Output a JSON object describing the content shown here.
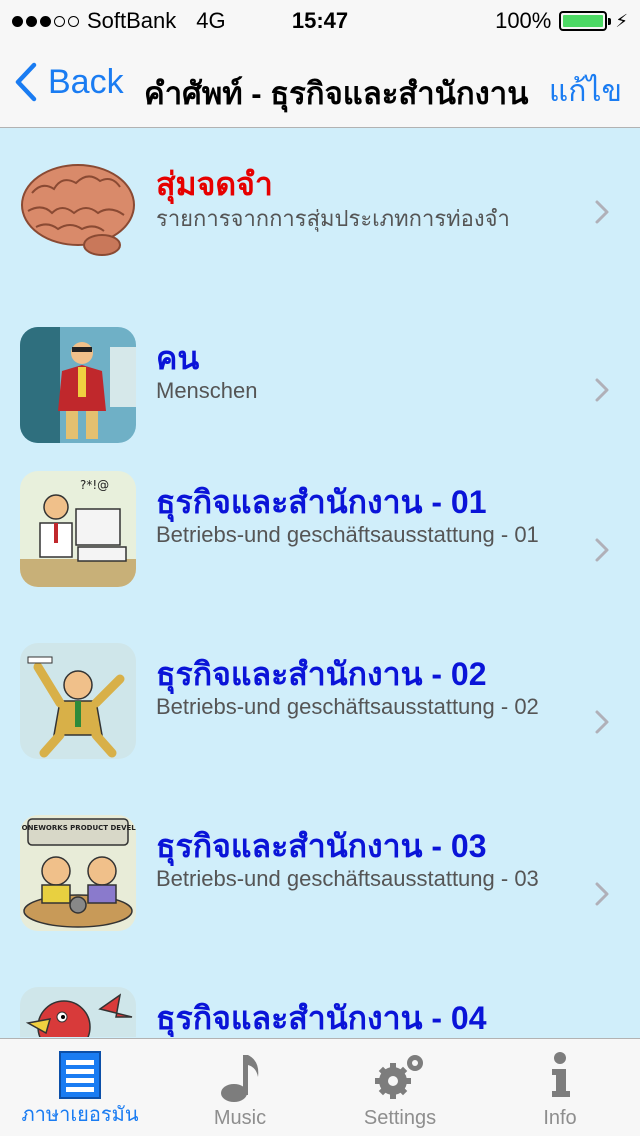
{
  "status": {
    "carrier": "SoftBank",
    "network": "4G",
    "time": "15:47",
    "battery": "100%",
    "signal_bars_filled": 3,
    "signal_bars_total": 5
  },
  "nav": {
    "back_label": "Back",
    "title": "คำศัพท์ - ธุรกิจและสำนักงาน",
    "edit_label": "แก้ไข"
  },
  "rows": [
    {
      "title": "สุ่มจดจำ",
      "subtitle": "รายการจากการสุ่มประเภทการท่องจำ",
      "icon": "brain-icon",
      "title_color": "#e60000"
    },
    {
      "title": "คน",
      "subtitle": "Menschen",
      "icon": "businessman-icon",
      "title_color": "#0a14d8"
    },
    {
      "title": "ธุรกิจและสำนักงาน - 01",
      "subtitle": "Betriebs-und geschäftsausstattung - 01",
      "icon": "computer-worker-icon",
      "title_color": "#0a14d8"
    },
    {
      "title": "ธุรกิจและสำนักงาน - 02",
      "subtitle": "Betriebs-und geschäftsausstattung - 02",
      "icon": "cheering-man-icon",
      "title_color": "#0a14d8"
    },
    {
      "title": "ธุรกิจและสำนักงาน - 03",
      "subtitle": "Betriebs-und geschäftsausstattung - 03",
      "icon": "cavemen-sign-icon",
      "title_color": "#0a14d8"
    },
    {
      "title": "ธุรกิจและสำนักงาน - 04",
      "subtitle": "",
      "icon": "bird-icon",
      "title_color": "#0a14d8"
    }
  ],
  "thumb_texts": {
    "sign": "ACME STONEWORKS PRODUCT DEVELOPMENT"
  },
  "tabs": [
    {
      "label": "ภาษาเยอรมัน",
      "icon": "list-icon",
      "active": true
    },
    {
      "label": "Music",
      "icon": "music-note-icon",
      "active": false
    },
    {
      "label": "Settings",
      "icon": "gears-icon",
      "active": false
    },
    {
      "label": "Info",
      "icon": "info-icon",
      "active": false
    }
  ],
  "colors": {
    "accent": "#1a7cf2",
    "list_background": "#d0eefa",
    "title_blue": "#0a14d8",
    "title_red": "#e60000"
  }
}
